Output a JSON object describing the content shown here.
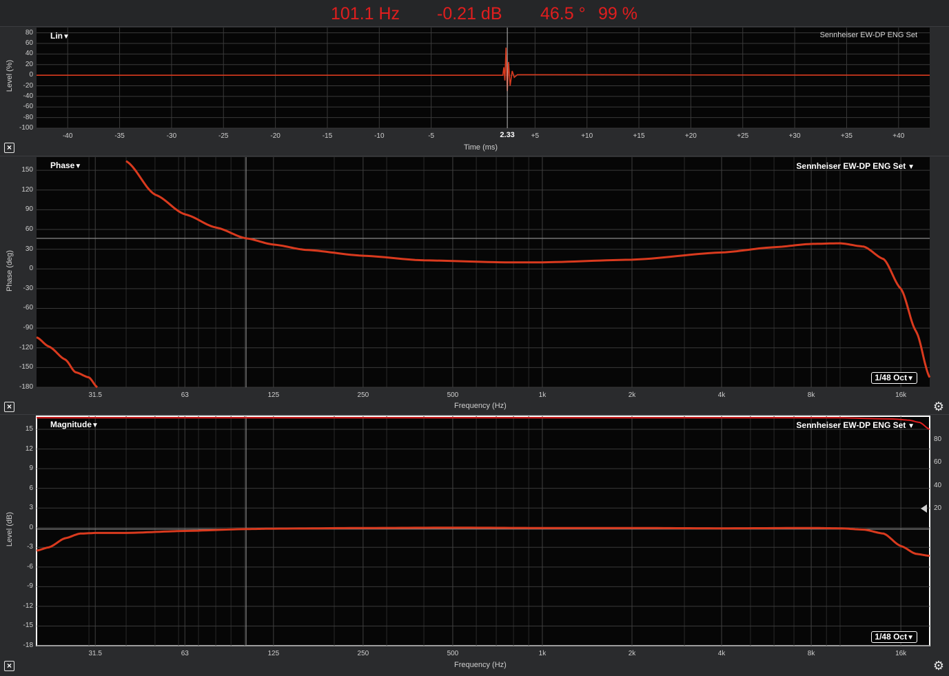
{
  "readout": {
    "frequency": "101.1 Hz",
    "level": "-0.21 dB",
    "phase": "46.5 °",
    "coherence": "99 %"
  },
  "colors": {
    "trace": "#d93a1e",
    "readout": "#e01e1e",
    "grid": "#3a3a3a",
    "cursor": "#8a8a8a",
    "plot_bg": "#060606"
  },
  "impulse": {
    "mode_label": "Lin",
    "device": "Sennheiser EW-DP ENG Set",
    "y_label": "Level (%)",
    "x_label": "Time (ms)",
    "y_ticks": [
      "80",
      "60",
      "40",
      "20",
      "0",
      "-20",
      "-40",
      "-60",
      "-80",
      "-100"
    ],
    "x_ticks": [
      "-40",
      "-35",
      "-30",
      "-25",
      "-20",
      "-15",
      "-10",
      "-5",
      "2.33",
      "+5",
      "+10",
      "+15",
      "+20",
      "+25",
      "+30",
      "+35",
      "+40"
    ],
    "cursor_ms": "2.33",
    "close_icon": "close-icon"
  },
  "phase": {
    "mode_label": "Phase",
    "device": "Sennheiser EW-DP ENG Set",
    "y_label": "Phase (deg)",
    "x_label": "Frequency (Hz)",
    "y_ticks": [
      "150",
      "120",
      "90",
      "60",
      "30",
      "0",
      "-30",
      "-60",
      "-90",
      "-120",
      "-150",
      "-180"
    ],
    "x_ticks": [
      "31.5",
      "63",
      "125",
      "250",
      "500",
      "1k",
      "2k",
      "4k",
      "8k",
      "16k"
    ],
    "smoothing": "1/48 Oct",
    "close_icon": "close-icon",
    "gear_icon": "gear-icon"
  },
  "magnitude": {
    "mode_label": "Magnitude",
    "device": "Sennheiser EW-DP ENG Set",
    "y_label": "Level (dB)",
    "x_label": "Frequency (Hz)",
    "y_ticks": [
      "15",
      "12",
      "9",
      "6",
      "3",
      "0",
      "-3",
      "-6",
      "-9",
      "-12",
      "-15",
      "-18"
    ],
    "coherence_ticks": [
      "80",
      "60",
      "40",
      "20"
    ],
    "x_ticks": [
      "31.5",
      "63",
      "125",
      "250",
      "500",
      "1k",
      "2k",
      "4k",
      "8k",
      "16k"
    ],
    "smoothing": "1/48 Oct",
    "close_icon": "close-icon",
    "gear_icon": "gear-icon"
  },
  "chart_data": [
    {
      "type": "line",
      "title": "",
      "xlabel": "Time (ms)",
      "ylabel": "Level (%)",
      "xlim": [
        -43,
        43
      ],
      "ylim": [
        -100,
        90
      ],
      "cursor_x": 2.33,
      "series": [
        {
          "x": [
            -43,
            1.9,
            2.0,
            2.1,
            2.2,
            2.33,
            2.45,
            2.6,
            2.8,
            3.0,
            3.3,
            43
          ],
          "y": [
            0,
            0,
            15,
            -10,
            52,
            -30,
            25,
            -20,
            8,
            -4,
            1,
            0
          ]
        }
      ]
    },
    {
      "type": "line",
      "title": "",
      "xlabel": "Frequency (Hz)",
      "ylabel": "Phase (deg)",
      "x_scale": "log",
      "xlim": [
        20,
        20000
      ],
      "ylim": [
        -180,
        170
      ],
      "cursor": {
        "x": 101.1,
        "y": 46.5
      },
      "series": [
        {
          "x": [
            40,
            50,
            63,
            80,
            101.1,
            125,
            160,
            250,
            400,
            750,
            1000,
            2000,
            4000,
            6000,
            8000,
            10000,
            12000,
            14000,
            16000,
            18000,
            20000
          ],
          "y": [
            164,
            113,
            83,
            63,
            46.5,
            37,
            29,
            20,
            13,
            10,
            10,
            14,
            25,
            33,
            38,
            39,
            34,
            15,
            -30,
            -95,
            -165
          ]
        },
        {
          "x": [
            20,
            22,
            25,
            27,
            30,
            32
          ],
          "y": [
            -104,
            -118,
            -138,
            -157,
            -165,
            -180
          ]
        }
      ]
    },
    {
      "type": "line",
      "title": "",
      "xlabel": "Frequency (Hz)",
      "ylabel": "Level (dB)",
      "x_scale": "log",
      "xlim": [
        20,
        20000
      ],
      "ylim": [
        -18,
        17
      ],
      "cursor": {
        "x": 101.1,
        "y": -0.21
      },
      "series": [
        {
          "x": [
            20,
            22,
            25,
            28,
            32,
            40,
            63,
            101.1,
            125,
            250,
            500,
            1000,
            2000,
            4000,
            8000,
            10000,
            12000,
            14000,
            16000,
            18000,
            20000
          ],
          "y": [
            -3.5,
            -3.0,
            -1.6,
            -0.9,
            -0.8,
            -0.8,
            -0.5,
            -0.21,
            -0.15,
            -0.05,
            0,
            -0.05,
            -0.05,
            -0.1,
            -0.05,
            -0.1,
            -0.3,
            -0.9,
            -2.8,
            -4.0,
            -4.3
          ]
        },
        {
          "x": [
            20,
            1000,
            10000,
            15000,
            17000,
            18500,
            20000
          ],
          "y": [
            99,
            99,
            99,
            98,
            97,
            95,
            89
          ]
        }
      ],
      "y2_label_ticks": [
        80,
        60,
        40,
        20
      ]
    }
  ]
}
